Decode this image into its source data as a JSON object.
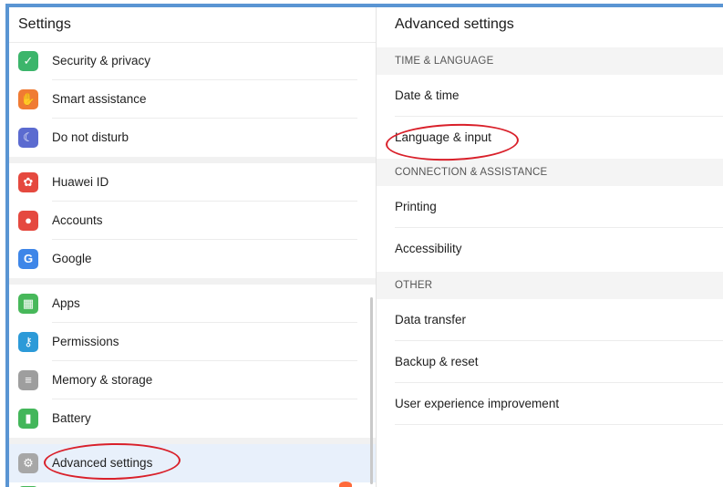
{
  "left_panel": {
    "title": "Settings",
    "items": [
      {
        "label": "Security & privacy",
        "icon": "shield-icon",
        "color": "#3cb56b",
        "glyph": "✓"
      },
      {
        "label": "Smart assistance",
        "icon": "hand-icon",
        "color": "#f07b33",
        "glyph": "✋"
      },
      {
        "label": "Do not disturb",
        "icon": "moon-icon",
        "color": "#5b6bd0",
        "glyph": "☾"
      },
      {
        "label": "Huawei ID",
        "icon": "huawei-icon",
        "color": "#e5493f",
        "glyph": "✿"
      },
      {
        "label": "Accounts",
        "icon": "account-icon",
        "color": "#e5493f",
        "glyph": "●"
      },
      {
        "label": "Google",
        "icon": "google-icon",
        "color": "#3e86e8",
        "glyph": "G"
      },
      {
        "label": "Apps",
        "icon": "apps-icon",
        "color": "#47b85a",
        "glyph": "▦"
      },
      {
        "label": "Permissions",
        "icon": "key-icon",
        "color": "#2c9ad8",
        "glyph": "⚷"
      },
      {
        "label": "Memory & storage",
        "icon": "storage-icon",
        "color": "#9e9e9e",
        "glyph": "≡"
      },
      {
        "label": "Battery",
        "icon": "battery-icon",
        "color": "#43b65a",
        "glyph": "▮"
      },
      {
        "label": "Advanced settings",
        "icon": "gear-icon",
        "color": "#a7a7a7",
        "glyph": "⚙"
      }
    ]
  },
  "right_panel": {
    "title": "Advanced settings",
    "sections": [
      {
        "header": "TIME & LANGUAGE",
        "items": [
          "Date & time",
          "Language & input"
        ]
      },
      {
        "header": "CONNECTION & ASSISTANCE",
        "items": [
          "Printing",
          "Accessibility"
        ]
      },
      {
        "header": "OTHER",
        "items": [
          "Data transfer",
          "Backup & reset",
          "User experience improvement"
        ]
      }
    ]
  },
  "colors": {
    "accent": "#5a95d3",
    "annotation": "#d9202a",
    "selected": "#e8f0fb"
  }
}
